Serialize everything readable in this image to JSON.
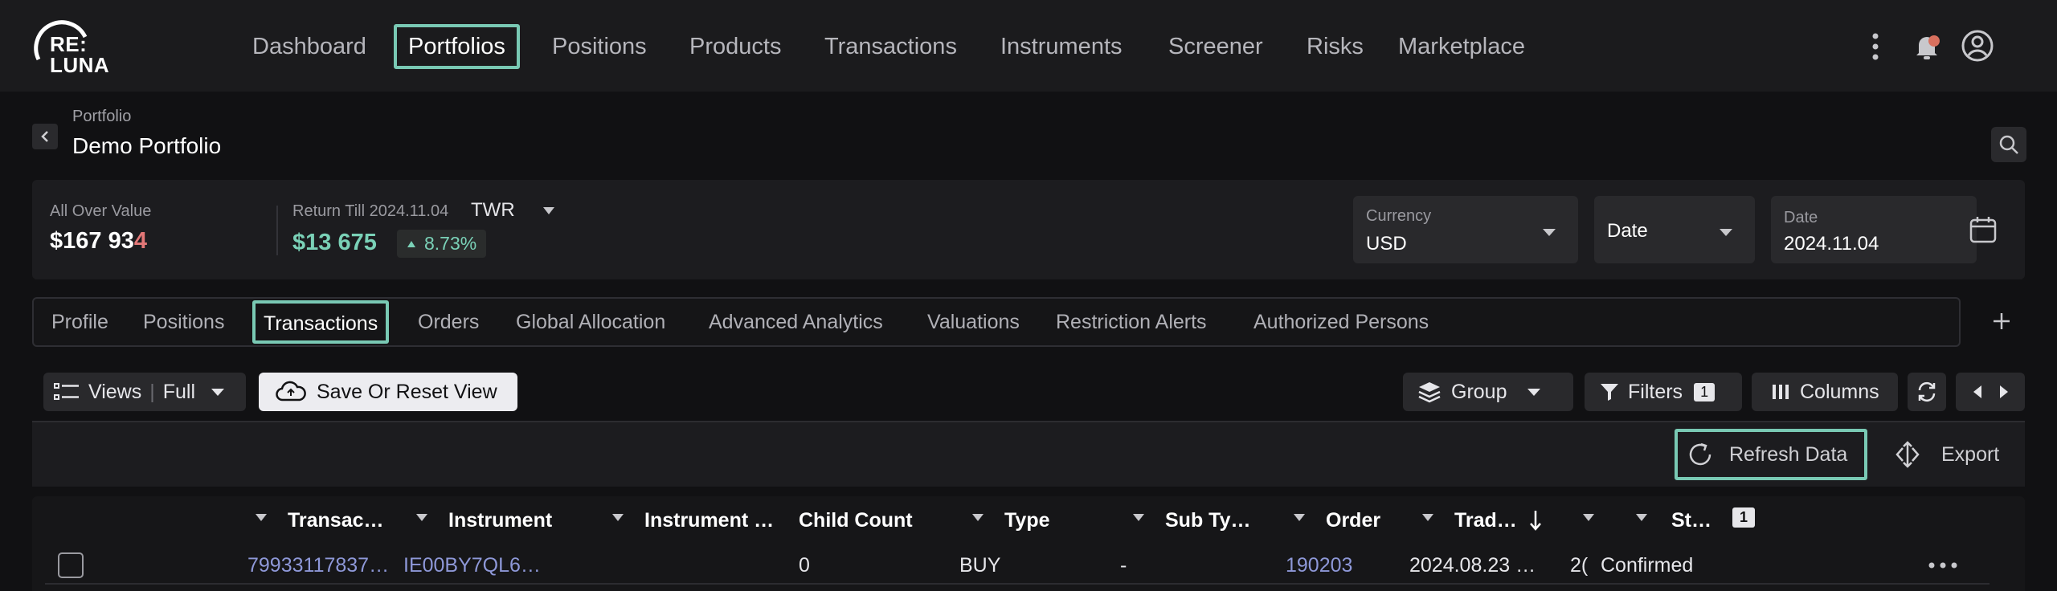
{
  "logo": {
    "line1": "RE:",
    "line2": "LUNA"
  },
  "nav": {
    "items": [
      {
        "label": "Dashboard"
      },
      {
        "label": "Portfolios",
        "active": true
      },
      {
        "label": "Positions"
      },
      {
        "label": "Products"
      },
      {
        "label": "Transactions"
      },
      {
        "label": "Instruments"
      },
      {
        "label": "Screener"
      },
      {
        "label": "Risks"
      },
      {
        "label": "Marketplace"
      }
    ],
    "icons": [
      "kebab-menu-icon",
      "bell-icon",
      "user-avatar-icon"
    ]
  },
  "portfolio": {
    "label": "Portfolio",
    "title": "Demo Portfolio"
  },
  "summary": {
    "all_over_label": "All Over Value",
    "all_over_value": "$167 93",
    "all_over_value_last": "4",
    "return_label": "Return Till 2024.11.04",
    "return_method": "TWR",
    "return_value": "$13 675",
    "return_pct": "8.73%",
    "currency_label": "Currency",
    "currency_value": "USD",
    "date_mode": "Date",
    "date_label": "Date",
    "date_value": "2024.11.04"
  },
  "tabs": [
    {
      "label": "Profile"
    },
    {
      "label": "Positions"
    },
    {
      "label": "Transactions",
      "active": true
    },
    {
      "label": "Orders"
    },
    {
      "label": "Global Allocation"
    },
    {
      "label": "Advanced Analytics"
    },
    {
      "label": "Valuations"
    },
    {
      "label": "Restriction Alerts"
    },
    {
      "label": "Authorized Persons"
    }
  ],
  "toolbar": {
    "views_label": "Views",
    "views_value": "Full",
    "save_reset_label": "Save Or Reset View",
    "group_label": "Group",
    "filters_label": "Filters",
    "filters_count": "1",
    "columns_label": "Columns"
  },
  "subtoolbar": {
    "refresh_label": "Refresh Data",
    "export_label": "Export"
  },
  "table": {
    "headers": {
      "transaction": "Transac…",
      "instrument": "Instrument",
      "instrument2": "Instrument …",
      "child_count": "Child Count",
      "type": "Type",
      "sub_type": "Sub Ty…",
      "order": "Order",
      "trade": "Trad…",
      "status": "St…",
      "status_badge": "1"
    },
    "rows": [
      {
        "transaction": "79933117837…",
        "instrument": "IE00BY7QL6…",
        "child_count": "0",
        "type": "BUY",
        "sub_type": "-",
        "order": "190203",
        "trade_date": "2024.08.23 …",
        "cut_value": "2(",
        "status": "Confirmed"
      }
    ]
  },
  "colors": {
    "accent": "#79c9b4",
    "link": "#8e98d8",
    "background": "#111113",
    "surface": "#1c1c1f"
  }
}
